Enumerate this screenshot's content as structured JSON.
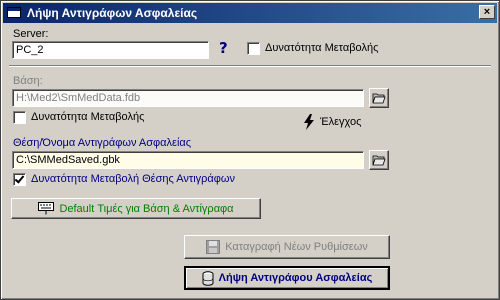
{
  "window": {
    "title": "Λήψη Αντιγράφων Ασφαλείας",
    "close_glyph": "×"
  },
  "server": {
    "label": "Server:",
    "value": "PC_2",
    "help_glyph": "?",
    "modify_label": "Δυνατότητα Μεταβολής",
    "modify_checked": false
  },
  "database": {
    "label": "Βάση:",
    "value": "H:\\Med2\\SmMedData.fdb",
    "modify_label": "Δυνατότητα Μεταβολής",
    "modify_checked": false,
    "check_label": "Έλεγχος"
  },
  "backup": {
    "label": "Θέση/Όνομα Αντιγράφων Ασφαλείας",
    "value": "C:\\SMMedSaved.gbk",
    "modify_label": "Δυνατότητα Μεταβολή Θέσης Αντιγράφων",
    "modify_checked": true
  },
  "buttons": {
    "defaults_label": "Default Τιμές για Βάση & Αντίγραφα",
    "save_settings_label": "Καταγραφή Νέων Ρυθμίσεων",
    "take_backup_label": "Λήψη Αντιγράφου Ασφαλείας"
  },
  "colors": {
    "title_gradient_start": "#0a246a",
    "title_gradient_end": "#3a6ea5",
    "face": "#d4d0c8",
    "accent_blue": "#000080",
    "defaults_green": "#008000"
  }
}
